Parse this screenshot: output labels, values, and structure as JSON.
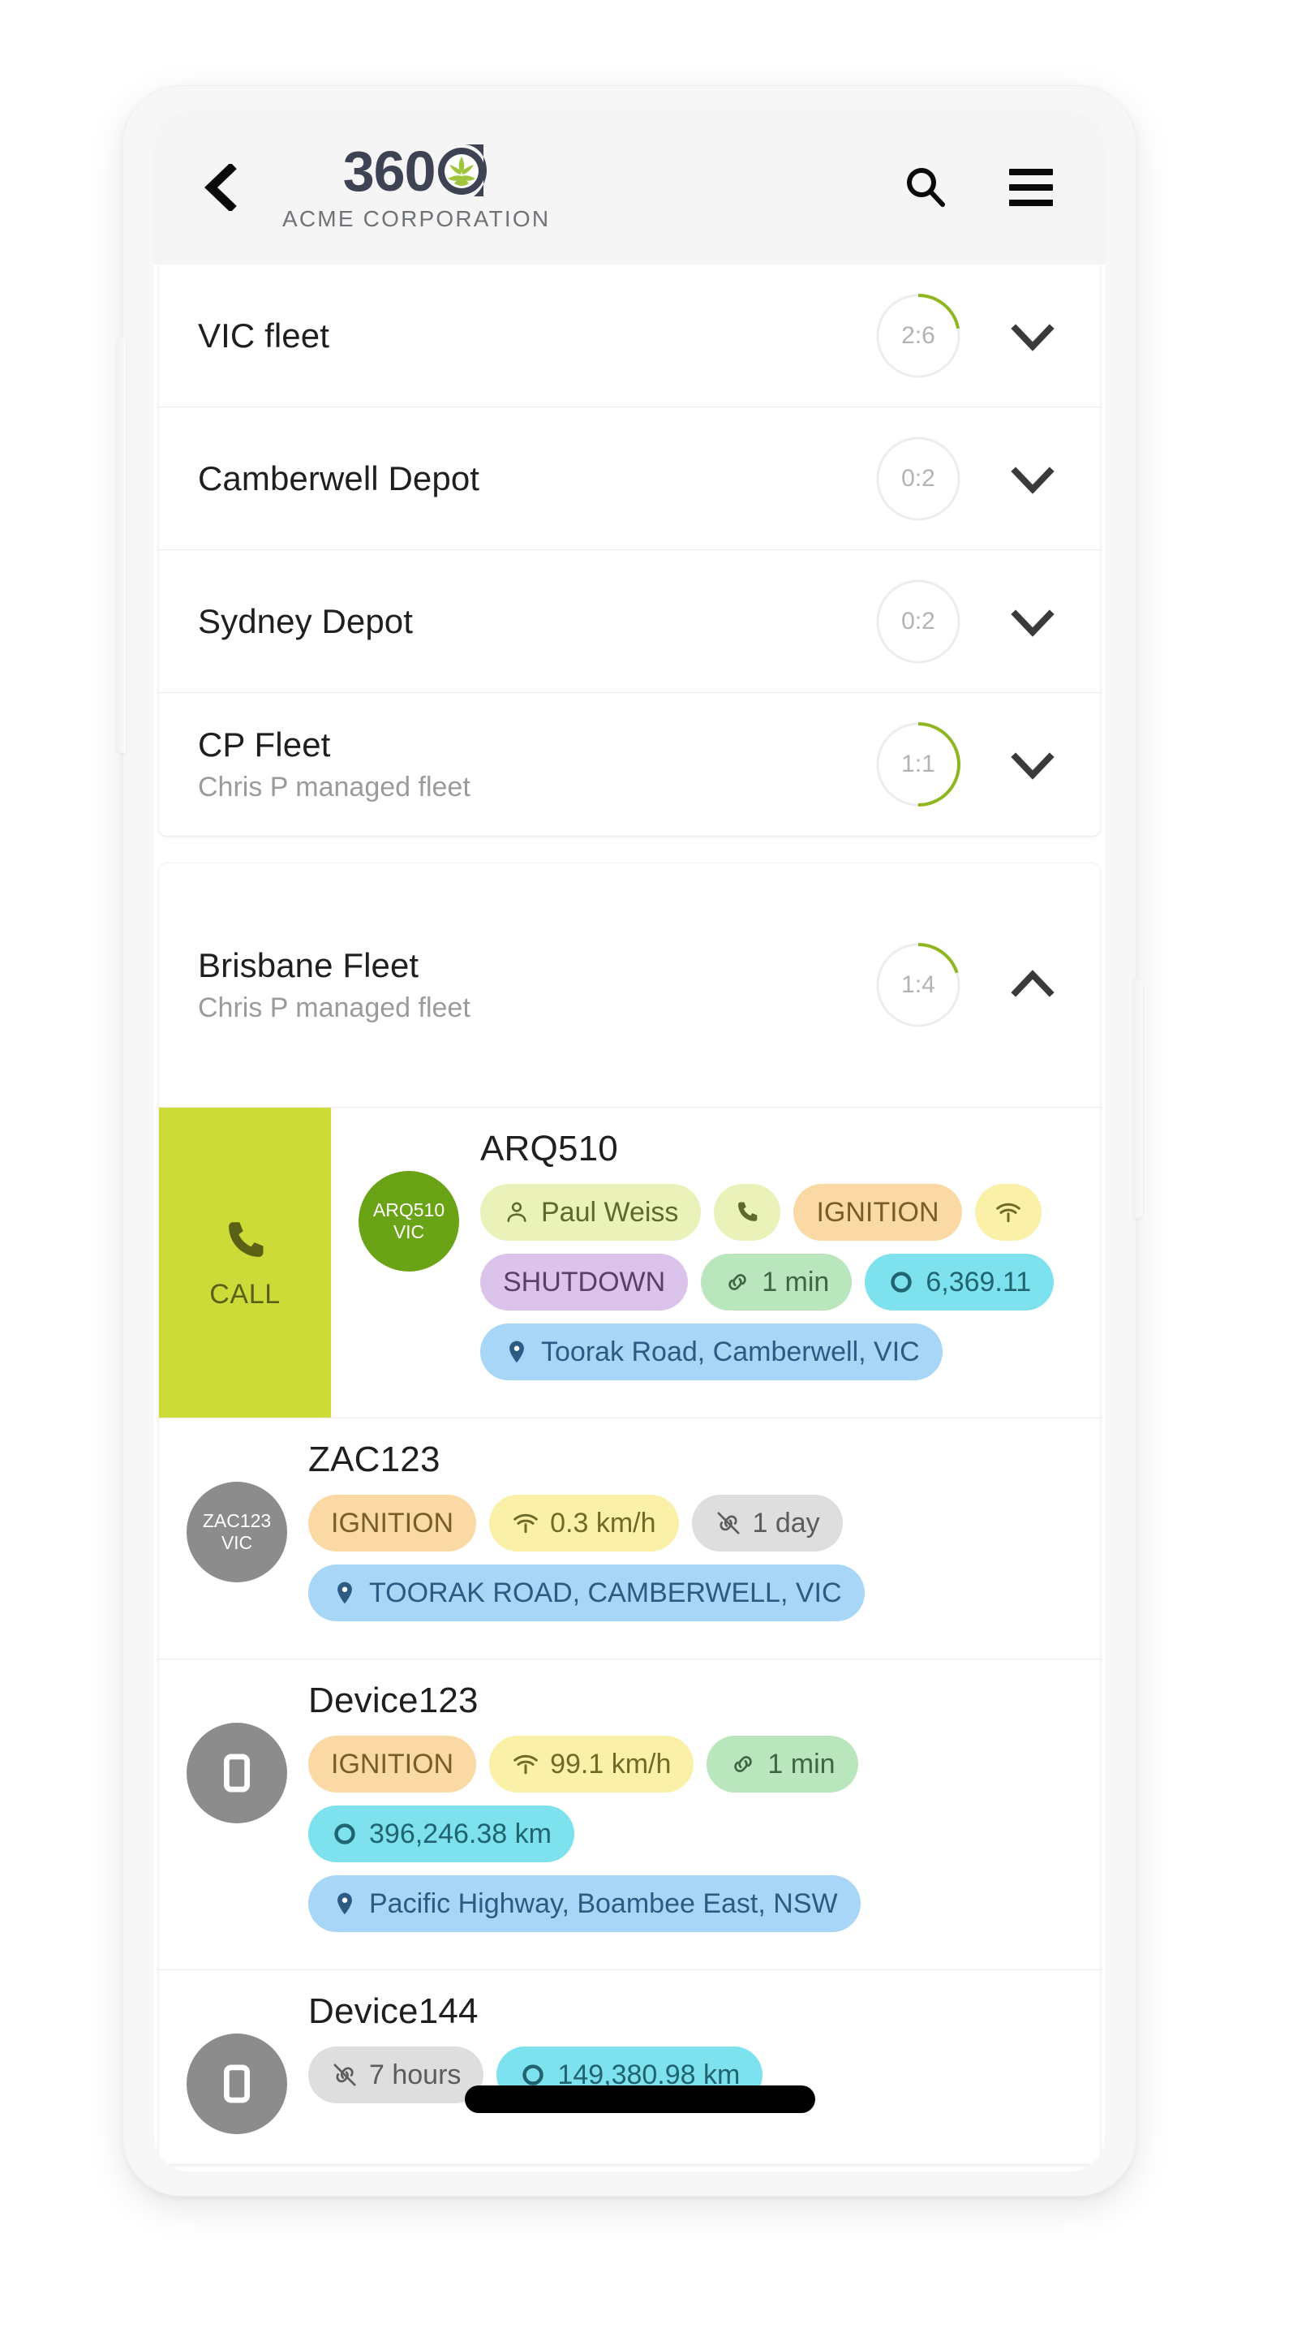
{
  "app_bar": {
    "back_icon": "chevron-left-icon",
    "logo_text": "360",
    "company": "ACME CORPORATION",
    "search_icon": "search-icon",
    "menu_icon": "hamburger-menu-icon",
    "logo_dark_color": "#3e4354",
    "logo_accent_color": "#9ec53b"
  },
  "groups": [
    {
      "name": "VIC fleet",
      "subtitle": "",
      "ratio": "2:6",
      "progress": 0.22,
      "expanded": false,
      "chevron": "chevron-down-icon"
    },
    {
      "name": "Camberwell Depot",
      "subtitle": "",
      "ratio": "0:2",
      "progress": 0.0,
      "expanded": false,
      "chevron": "chevron-down-icon"
    },
    {
      "name": "Sydney Depot",
      "subtitle": "",
      "ratio": "0:2",
      "progress": 0.0,
      "expanded": false,
      "chevron": "chevron-down-icon"
    },
    {
      "name": "CP Fleet",
      "subtitle": "Chris P managed fleet",
      "ratio": "1:1",
      "progress": 0.5,
      "expanded": false,
      "chevron": "chevron-down-icon"
    }
  ],
  "expanded_group": {
    "name": "Brisbane Fleet",
    "subtitle": "Chris P managed fleet",
    "ratio": "1:4",
    "progress": 0.2,
    "expanded": true,
    "chevron": "chevron-up-icon"
  },
  "swipe_action": {
    "label": "CALL",
    "icon": "phone-icon",
    "background": "#ccdb38",
    "foreground": "#5a6114"
  },
  "devices": [
    {
      "name": "ARQ510",
      "avatar": {
        "line1": "ARQ510",
        "line2": "VIC",
        "color": "#6aa316"
      },
      "swiped": true,
      "chips": [
        [
          {
            "icon": "person-icon",
            "text": "Paul Weiss",
            "bg": "#eaf2ba",
            "fg": "#5d6a2b"
          },
          {
            "icon": "phone-icon",
            "text": "",
            "bg": "#eaf2ba",
            "fg": "#5d6a2b",
            "icon_only": true
          },
          {
            "icon": "",
            "text": "IGNITION",
            "bg": "#fad9a5",
            "fg": "#7b5b29"
          },
          {
            "icon": "speed-icon",
            "text": "",
            "bg": "#fbf0a8",
            "fg": "#6e6a28",
            "icon_only": true
          }
        ],
        [
          {
            "icon": "",
            "text": "SHUTDOWN",
            "bg": "#dcc3ec",
            "fg": "#5a3e6b"
          },
          {
            "icon": "link-icon",
            "text": "1 min",
            "bg": "#b9e6bd",
            "fg": "#3f6642"
          },
          {
            "icon": "odometer-icon",
            "text": "6,369.11",
            "bg": "#7de2ed",
            "fg": "#1f6470"
          }
        ],
        [
          {
            "icon": "pin-icon",
            "text": "Toorak Road, Camberwell, VIC",
            "bg": "#a8d6f7",
            "fg": "#2d5a82"
          }
        ]
      ]
    },
    {
      "name": "ZAC123",
      "avatar": {
        "line1": "ZAC123",
        "line2": "VIC",
        "color": "#8c8c8c"
      },
      "swiped": false,
      "chips": [
        [
          {
            "icon": "",
            "text": "IGNITION",
            "bg": "#fad9a5",
            "fg": "#7b5b29"
          },
          {
            "icon": "speed-icon",
            "text": "0.3 km/h",
            "bg": "#fbf0a8",
            "fg": "#6e6a28"
          },
          {
            "icon": "link-off-icon",
            "text": "1 day",
            "bg": "#dedede",
            "fg": "#5c5c5c"
          }
        ],
        [
          {
            "icon": "pin-icon",
            "text": "TOORAK ROAD, CAMBERWELL, VIC",
            "bg": "#a8d6f7",
            "fg": "#2d5a82"
          }
        ]
      ]
    },
    {
      "name": "Device123",
      "avatar": {
        "line1": "",
        "line2": "",
        "color": "#8c8c8c",
        "icon": "device-icon"
      },
      "swiped": false,
      "chips": [
        [
          {
            "icon": "",
            "text": "IGNITION",
            "bg": "#fad9a5",
            "fg": "#7b5b29"
          },
          {
            "icon": "speed-icon",
            "text": "99.1 km/h",
            "bg": "#fbf0a8",
            "fg": "#6e6a28"
          },
          {
            "icon": "link-icon",
            "text": "1 min",
            "bg": "#b9e6bd",
            "fg": "#3f6642"
          }
        ],
        [
          {
            "icon": "odometer-icon",
            "text": "396,246.38 km",
            "bg": "#7de2ed",
            "fg": "#1f6470"
          }
        ],
        [
          {
            "icon": "pin-icon",
            "text": "Pacific Highway, Boambee East, NSW",
            "bg": "#a8d6f7",
            "fg": "#2d5a82"
          }
        ]
      ]
    },
    {
      "name": "Device144",
      "avatar": {
        "line1": "",
        "line2": "",
        "color": "#8c8c8c",
        "icon": "device-icon"
      },
      "swiped": false,
      "chips": [
        [
          {
            "icon": "link-off-icon",
            "text": "7 hours",
            "bg": "#dedede",
            "fg": "#5c5c5c"
          },
          {
            "icon": "odometer-icon",
            "text": "149,380.98 km",
            "bg": "#7de2ed",
            "fg": "#1f6470"
          }
        ]
      ]
    }
  ]
}
